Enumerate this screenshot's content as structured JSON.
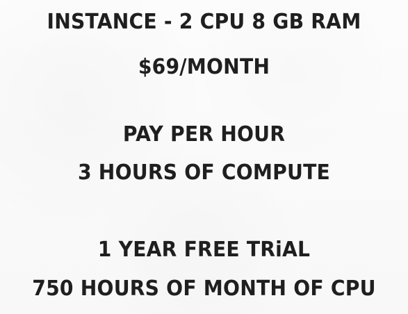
{
  "note": {
    "lines": [
      "INSTANCE - 2 CPU 8 GB RAM",
      "$69/MONTH",
      "PAY PER HOUR",
      "3 HOURS OF COMPUTE",
      "1 YEAR FREE TRiAL",
      "750 HOURS OF MONTH OF CPU"
    ]
  }
}
